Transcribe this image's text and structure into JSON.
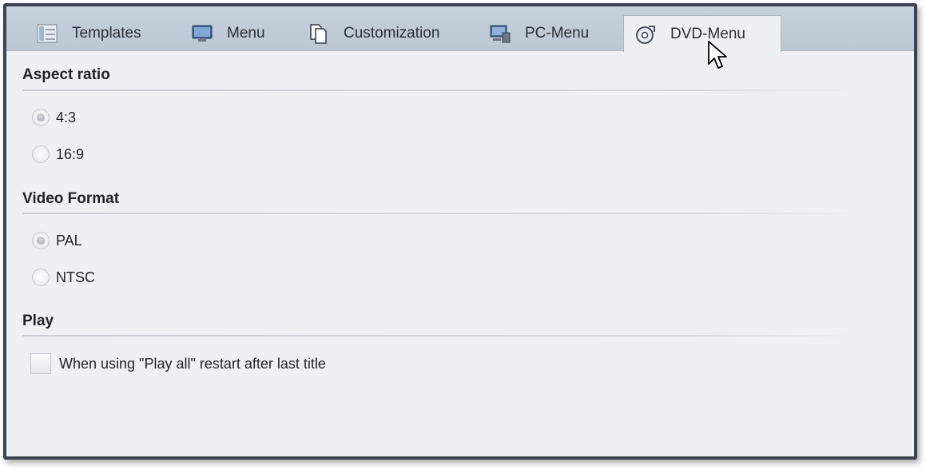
{
  "tabs": [
    {
      "label": "Templates",
      "icon": "templates-icon"
    },
    {
      "label": "Menu",
      "icon": "monitor-icon"
    },
    {
      "label": "Customization",
      "icon": "pages-icon"
    },
    {
      "label": "PC-Menu",
      "icon": "pc-menu-icon"
    },
    {
      "label": "DVD-Menu",
      "icon": "dvd-icon",
      "active": true
    }
  ],
  "sections": {
    "aspect": {
      "title": "Aspect ratio",
      "options": [
        {
          "label": "4:3",
          "checked": true
        },
        {
          "label": "16:9",
          "checked": false
        }
      ]
    },
    "video": {
      "title": "Video Format",
      "options": [
        {
          "label": "PAL",
          "checked": true
        },
        {
          "label": "NTSC",
          "checked": false
        }
      ]
    },
    "play": {
      "title": "Play",
      "checkbox_label": "When using \"Play all\" restart after last title",
      "checked": false
    }
  },
  "colors": {
    "frame": "#3a4352",
    "tabbar": "#c7d1dd",
    "panel": "#eef0f4"
  }
}
